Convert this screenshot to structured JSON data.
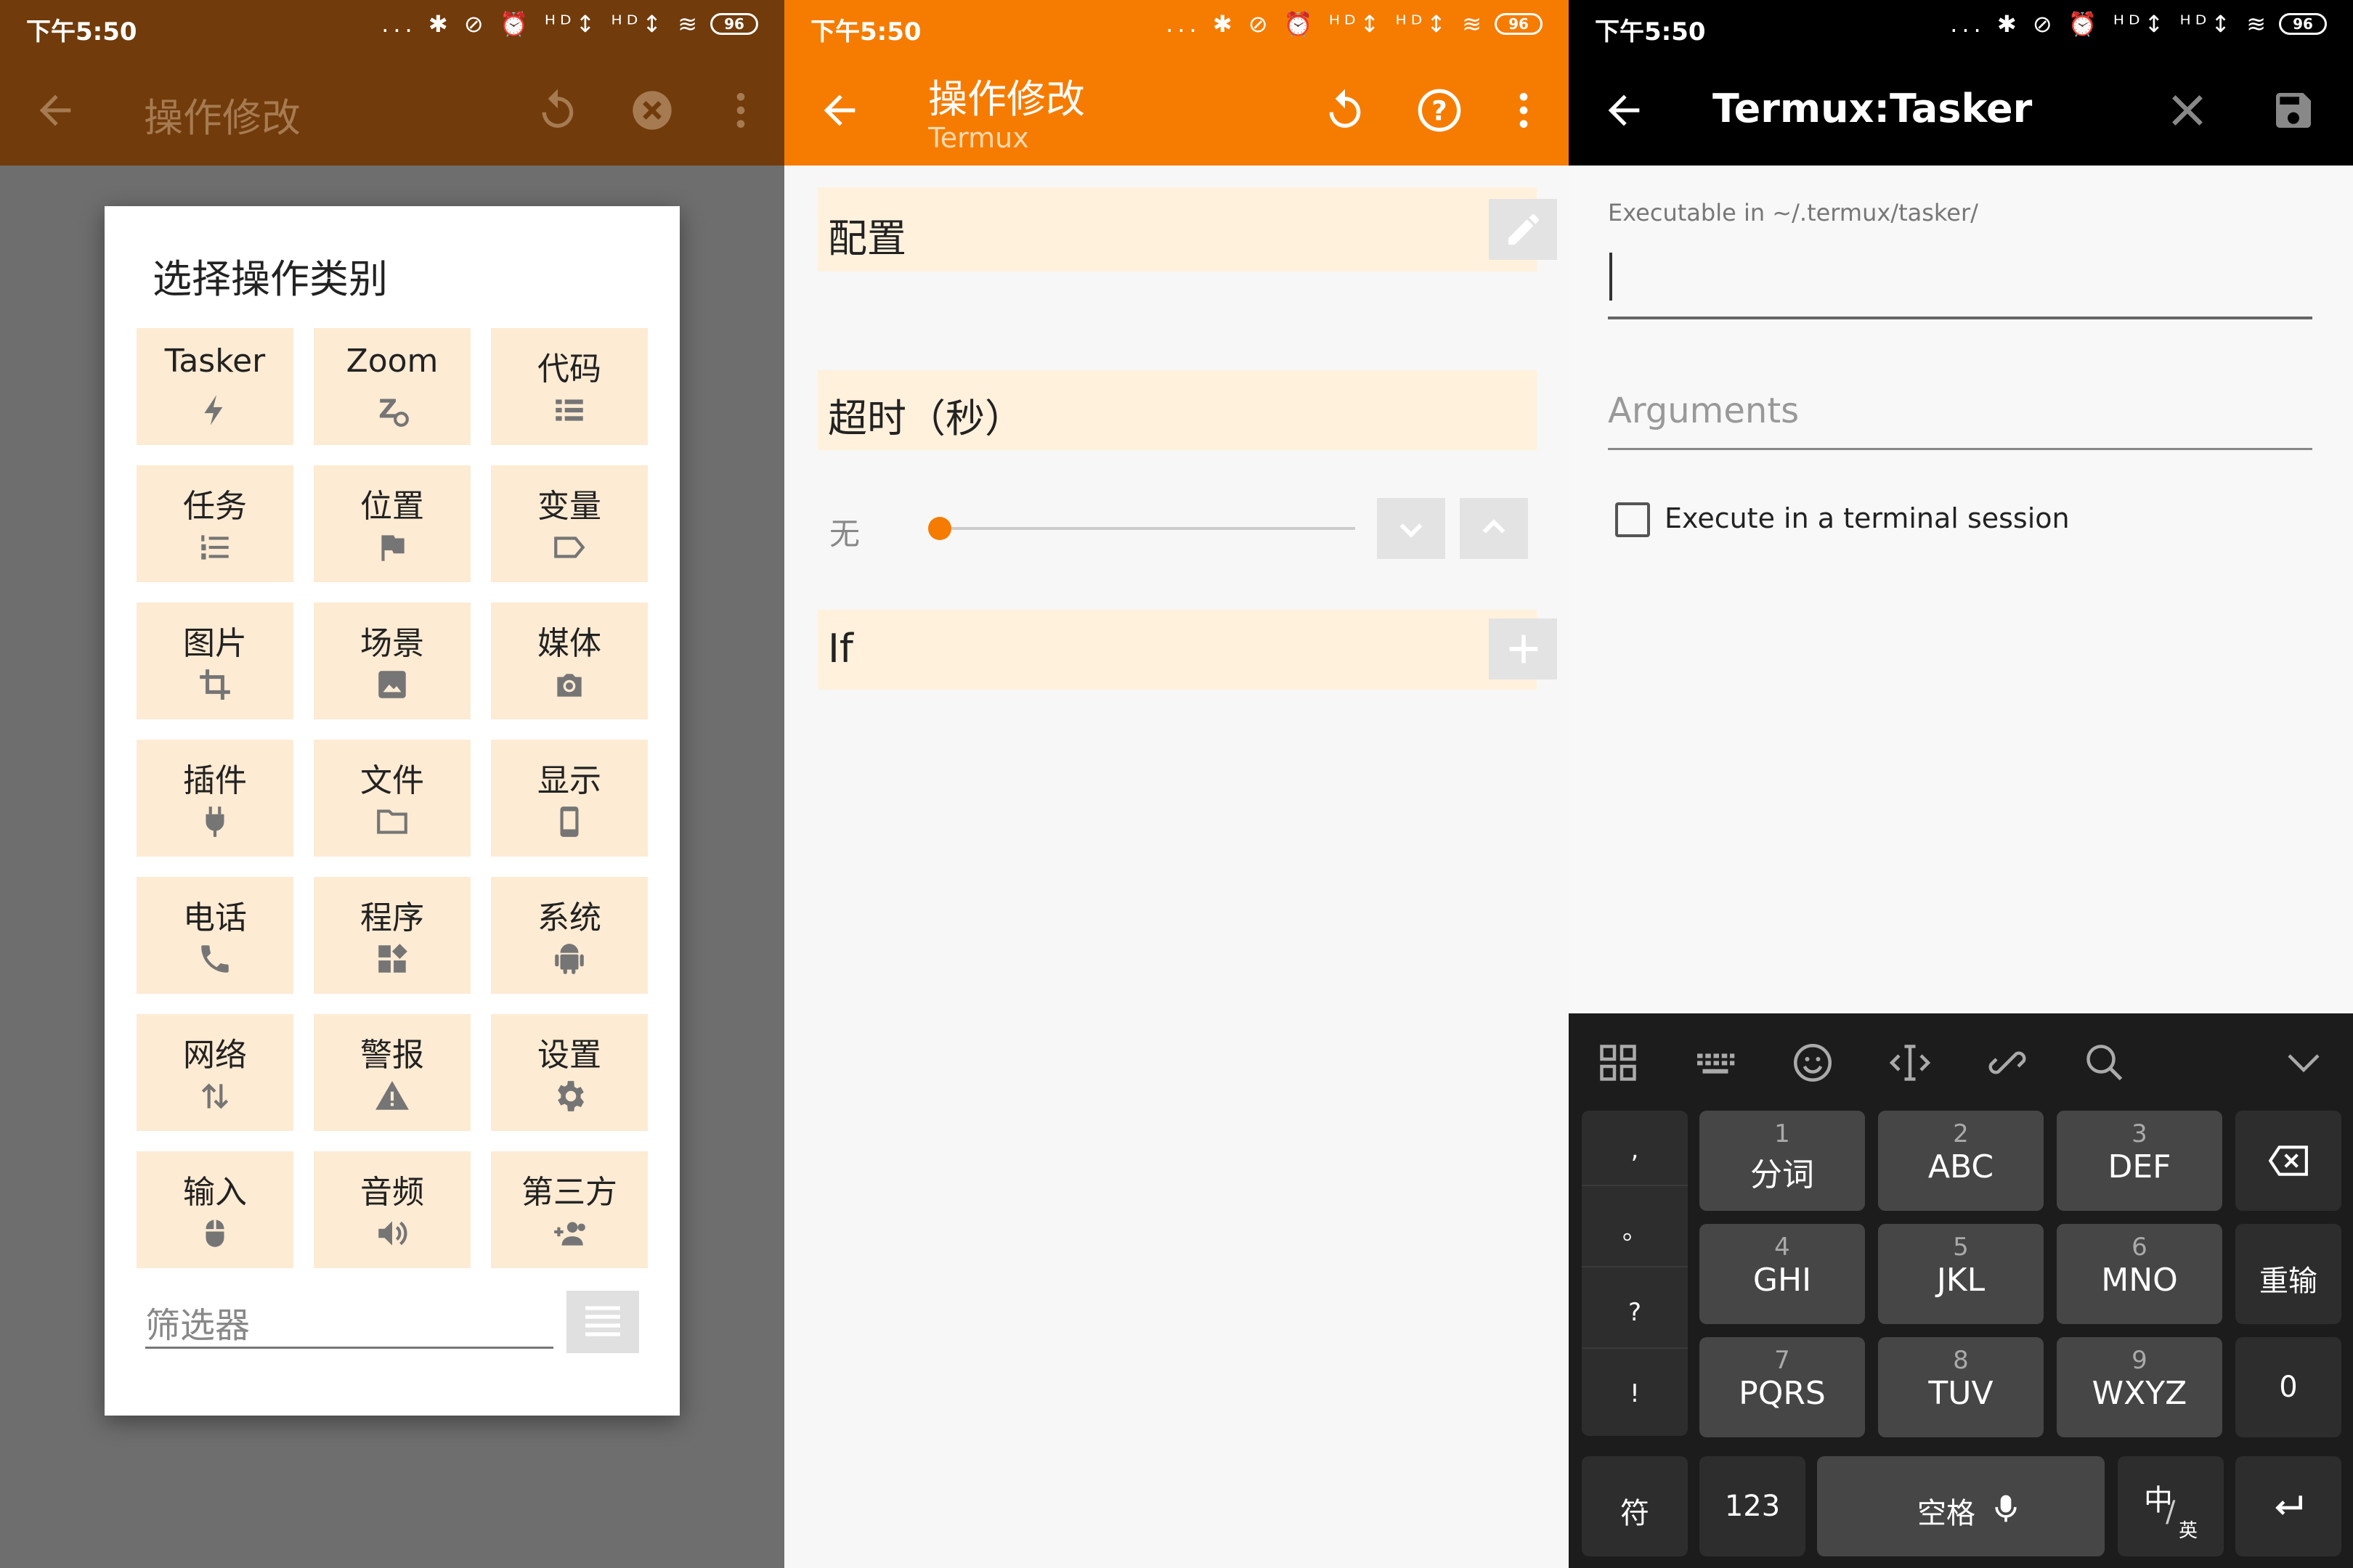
{
  "status": {
    "time": "下午5:50",
    "icons_text": "... ✱ ⊘ ⏰ ᴴᴰ↕ ᴴᴰ↕ ≋",
    "battery": "96"
  },
  "panel1": {
    "toolbar": {
      "title": "操作修改"
    },
    "dialog": {
      "title": "选择操作类别",
      "categories": [
        {
          "label": "Tasker",
          "icon": "bolt-icon"
        },
        {
          "label": "Zoom",
          "icon": "zoom-settings-icon"
        },
        {
          "label": "代码",
          "icon": "list-icon"
        },
        {
          "label": "任务",
          "icon": "numbered-list-icon"
        },
        {
          "label": "位置",
          "icon": "flag-icon"
        },
        {
          "label": "变量",
          "icon": "tag-icon"
        },
        {
          "label": "图片",
          "icon": "crop-icon"
        },
        {
          "label": "场景",
          "icon": "image-icon"
        },
        {
          "label": "媒体",
          "icon": "camera-icon"
        },
        {
          "label": "插件",
          "icon": "plug-icon"
        },
        {
          "label": "文件",
          "icon": "folder-icon"
        },
        {
          "label": "显示",
          "icon": "phone-display-icon"
        },
        {
          "label": "电话",
          "icon": "phone-icon"
        },
        {
          "label": "程序",
          "icon": "apps-icon"
        },
        {
          "label": "系统",
          "icon": "android-icon"
        },
        {
          "label": "网络",
          "icon": "updown-arrows-icon"
        },
        {
          "label": "警报",
          "icon": "warning-icon"
        },
        {
          "label": "设置",
          "icon": "gear-icon"
        },
        {
          "label": "输入",
          "icon": "mouse-icon"
        },
        {
          "label": "音频",
          "icon": "speaker-icon"
        },
        {
          "label": "第三方",
          "icon": "people-add-icon"
        }
      ],
      "filter_placeholder": "筛选器"
    }
  },
  "panel2": {
    "toolbar": {
      "title": "操作修改",
      "subtitle": "Termux"
    },
    "config_label": "配置",
    "timeout_label": "超时（秒）",
    "timeout_value_label": "无",
    "timeout_slider_value": 0,
    "if_label": "If"
  },
  "panel3": {
    "toolbar": {
      "title": "Termux:Tasker"
    },
    "executable_label": "Executable in ~/.termux/tasker/",
    "executable_value": "",
    "arguments_placeholder": "Arguments",
    "terminal_checkbox_label": "Execute in a terminal session",
    "terminal_checkbox_checked": false,
    "keyboard": {
      "side_punct": [
        ",",
        "。",
        "?",
        "!"
      ],
      "keys": [
        {
          "num": "1",
          "letters": "分词"
        },
        {
          "num": "2",
          "letters": "ABC"
        },
        {
          "num": "3",
          "letters": "DEF"
        },
        {
          "num": "4",
          "letters": "GHI"
        },
        {
          "num": "5",
          "letters": "JKL"
        },
        {
          "num": "6",
          "letters": "MNO"
        },
        {
          "num": "7",
          "letters": "PQRS"
        },
        {
          "num": "8",
          "letters": "TUV"
        },
        {
          "num": "9",
          "letters": "WXYZ"
        }
      ],
      "reenter": "重输",
      "zero": "0",
      "symbols": "符",
      "num_mode": "123",
      "space": "空格",
      "lang_zh": "中",
      "lang_en": "英"
    }
  },
  "colors": {
    "accent": "#f57c00",
    "accent_dark": "#713b0b",
    "tile": "#fdebd3",
    "section": "#fff1dc"
  }
}
